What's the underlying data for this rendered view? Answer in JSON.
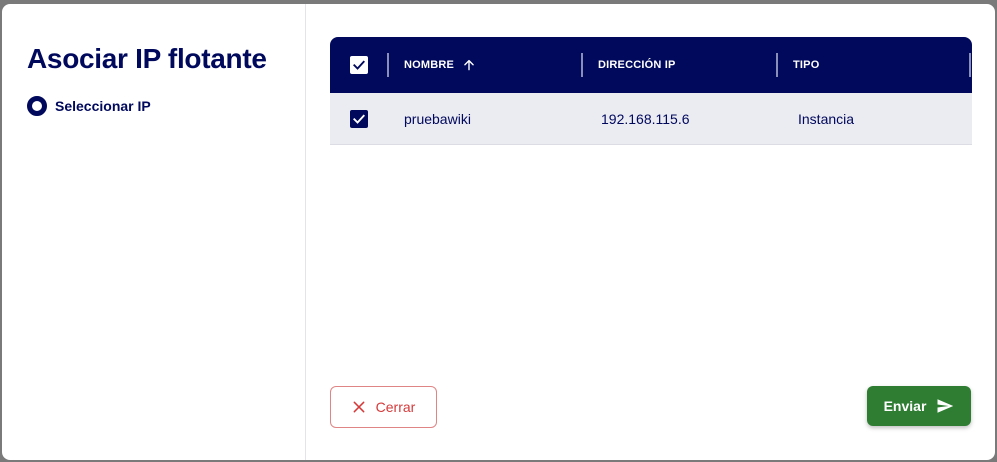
{
  "dialog": {
    "title": "Asociar IP flotante",
    "steps": [
      {
        "label": "Seleccionar IP"
      }
    ]
  },
  "table": {
    "columns": [
      {
        "label": "NOMBRE",
        "sort": "ascending"
      },
      {
        "label": "DIRECCIÓN IP"
      },
      {
        "label": "TIPO"
      }
    ],
    "header_checked": true,
    "rows": [
      {
        "checked": true,
        "nombre": "pruebawiki",
        "direccion_ip": "192.168.115.6",
        "tipo": "Instancia"
      }
    ]
  },
  "actions": {
    "close_label": "Cerrar",
    "submit_label": "Enviar"
  },
  "colors": {
    "primary": "#00095c",
    "success": "#2e7d32",
    "danger": "#d53a3a"
  },
  "icons": {
    "step": "radio-step-icon",
    "sort": "arrow-up-icon",
    "close": "x-icon",
    "submit": "send-icon",
    "check": "check-icon"
  }
}
